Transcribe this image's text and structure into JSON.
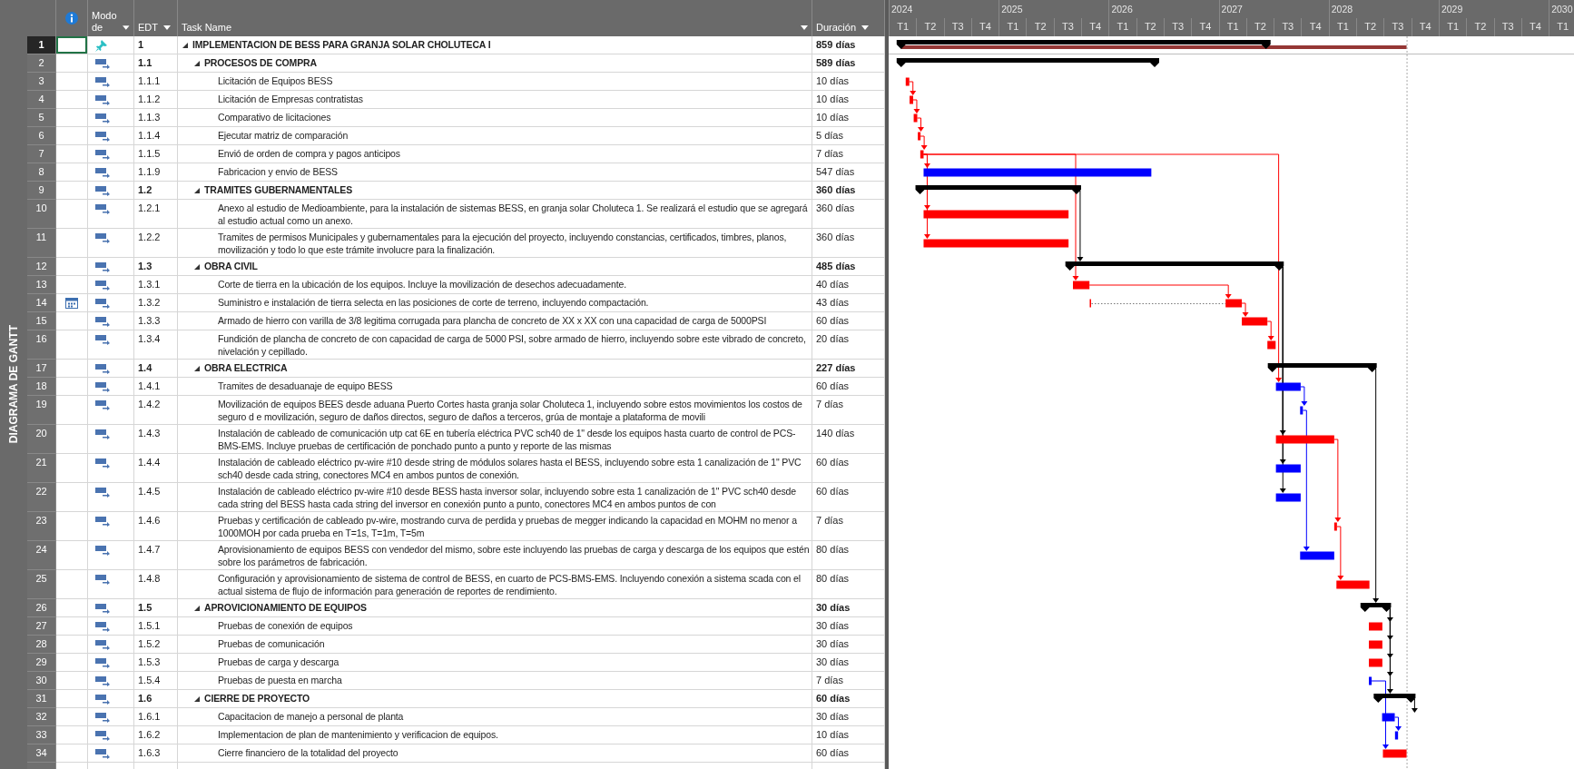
{
  "side_label": "DIAGRAMA DE GANTT",
  "columns": {
    "mode": "Modo de",
    "edt": "EDT",
    "name": "Task Name",
    "duration": "Duración"
  },
  "timeline": [
    {
      "year": "2024",
      "quarters": [
        "T1",
        "T2",
        "T3",
        "T4"
      ]
    },
    {
      "year": "2025",
      "quarters": [
        "T1",
        "T2",
        "T3",
        "T4"
      ]
    },
    {
      "year": "2026",
      "quarters": [
        "T1",
        "T2",
        "T3",
        "T4"
      ]
    },
    {
      "year": "2027",
      "quarters": [
        "T1",
        "T2",
        "T3",
        "T4"
      ]
    },
    {
      "year": "2028",
      "quarters": [
        "T1",
        "T2",
        "T3",
        "T4"
      ]
    },
    {
      "year": "2029",
      "quarters": [
        "T1",
        "T2",
        "T3",
        "T4"
      ]
    },
    {
      "year": "2030",
      "quarters": [
        "T1"
      ]
    }
  ],
  "tasks": [
    {
      "number": "1",
      "edt": "1",
      "name": "IMPLEMENTACION DE BESS PARA GRANJA SOLAR CHOLUTECA I",
      "duration": "859 días",
      "kind": "project",
      "manually_scheduled": true,
      "selected": true,
      "expanded": true,
      "children": [
        {
          "number": "2",
          "edt": "1.1",
          "name": "PROCESOS DE COMPRA",
          "duration": "589 días",
          "kind": "summary",
          "manually_scheduled": false,
          "selected": false,
          "expanded": true,
          "children": [
            {
              "number": "3",
              "edt": "1.1.1",
              "name": "Licitación de Equipos BESS",
              "duration": "10 días",
              "kind": "task",
              "manually_scheduled": false,
              "selected": false,
              "critical": true
            },
            {
              "number": "4",
              "edt": "1.1.2",
              "name": "Licitación de Empresas contratistas",
              "duration": "10 días",
              "kind": "task",
              "manually_scheduled": false,
              "selected": false,
              "critical": true
            },
            {
              "number": "5",
              "edt": "1.1.3",
              "name": "Comparativo de licitaciones",
              "duration": "10 días",
              "kind": "task",
              "manually_scheduled": false,
              "selected": false,
              "critical": true
            },
            {
              "number": "6",
              "edt": "1.1.4",
              "name": "Ejecutar matriz de comparación",
              "duration": "5 días",
              "kind": "task",
              "manually_scheduled": false,
              "selected": false,
              "critical": true
            },
            {
              "number": "7",
              "edt": "1.1.5",
              "name": "Envió de orden de compra y pagos anticipos",
              "duration": "7 días",
              "kind": "task",
              "manually_scheduled": false,
              "selected": false,
              "critical": true
            },
            {
              "number": "8",
              "edt": "1.1.9",
              "name": "Fabricacion y envio de BESS",
              "duration": "547 días",
              "kind": "task",
              "manually_scheduled": false,
              "selected": false,
              "critical": false
            }
          ]
        },
        {
          "number": "9",
          "edt": "1.2",
          "name": "TRAMITES GUBERNAMENTALES",
          "duration": "360 días",
          "kind": "summary",
          "manually_scheduled": false,
          "selected": false,
          "expanded": true,
          "children": [
            {
              "number": "10",
              "edt": "1.2.1",
              "name": "Anexo al estudio de Medioambiente, para la instalación de sistemas BESS, en granja solar Choluteca 1. Se realizará el estudio que se agregará al estudio actual como un anexo.",
              "duration": "360 días",
              "kind": "task",
              "manually_scheduled": false,
              "selected": false,
              "critical": true
            },
            {
              "number": "11",
              "edt": "1.2.2",
              "name": "Tramites de permisos Municipales y gubernamentales para la ejecución del proyecto, incluyendo constancias, certificados, timbres, planos, movilización y todo lo que este trámite involucre para la finalización.",
              "duration": "360 días",
              "kind": "task",
              "manually_scheduled": false,
              "selected": false,
              "critical": true
            }
          ]
        },
        {
          "number": "12",
          "edt": "1.3",
          "name": "OBRA CIVIL",
          "duration": "485 días",
          "kind": "summary",
          "manually_scheduled": false,
          "selected": false,
          "expanded": true,
          "children": [
            {
              "number": "13",
              "edt": "1.3.1",
              "name": "Corte de tierra en la ubicación de los equipos. Incluye la movilización de desechos adecuadamente.",
              "duration": "40 días",
              "kind": "task",
              "manually_scheduled": false,
              "selected": false,
              "critical": true
            },
            {
              "number": "14",
              "edt": "1.3.2",
              "name": "Suministro e instalación de tierra selecta en las posiciones de corte de terreno, incluyendo compactación.",
              "duration": "43 días",
              "kind": "task",
              "manually_scheduled": false,
              "selected": false,
              "critical": true,
              "calendar_indicator": true
            },
            {
              "number": "15",
              "edt": "1.3.3",
              "name": "Armado de hierro con varilla de 3/8 legitima corrugada para plancha de concreto de XX x XX con una capacidad de carga de 5000PSI",
              "duration": "60 días",
              "kind": "task",
              "manually_scheduled": false,
              "selected": false,
              "critical": true
            },
            {
              "number": "16",
              "edt": "1.3.4",
              "name": "Fundición de plancha de concreto de con capacidad de carga de 5000 PSI, sobre armado de hierro, incluyendo sobre este vibrado de concreto, nivelación y cepillado.",
              "duration": "20 días",
              "kind": "task",
              "manually_scheduled": false,
              "selected": false,
              "critical": true
            }
          ]
        },
        {
          "number": "17",
          "edt": "1.4",
          "name": "OBRA ELECTRICA",
          "duration": "227 días",
          "kind": "summary",
          "manually_scheduled": false,
          "selected": false,
          "expanded": true,
          "children": [
            {
              "number": "18",
              "edt": "1.4.1",
              "name": "Tramites de desaduanaje de equipo BESS",
              "duration": "60 días",
              "kind": "task",
              "manually_scheduled": false,
              "selected": false,
              "critical": false
            },
            {
              "number": "19",
              "edt": "1.4.2",
              "name": "Movilización de equipos BEES desde aduana Puerto Cortes hasta granja solar Choluteca 1, incluyendo sobre estos movimientos los costos de seguro d e movilización, seguro de daños directos, seguro de daños a terceros, grúa de montaje a plataforma de movili",
              "duration": "7 días",
              "kind": "task",
              "manually_scheduled": false,
              "selected": false,
              "critical": false
            },
            {
              "number": "20",
              "edt": "1.4.3",
              "name": "Instalación de cableado de comunicación utp cat 6E en tubería eléctrica PVC sch40 de 1\" desde los equipos hasta cuarto de control de PCS-BMS-EMS. Incluye pruebas de certificación de ponchado punto a punto y reporte de las mismas",
              "duration": "140 días",
              "kind": "task",
              "manually_scheduled": false,
              "selected": false,
              "critical": true
            },
            {
              "number": "21",
              "edt": "1.4.4",
              "name": "Instalación de cableado eléctrico pv-wire #10 desde string de módulos solares hasta el BESS, incluyendo sobre esta 1 canalización de 1\" PVC sch40 desde cada string, conectores MC4 en ambos puntos de conexión.",
              "duration": "60 días",
              "kind": "task",
              "manually_scheduled": false,
              "selected": false,
              "critical": false
            },
            {
              "number": "22",
              "edt": "1.4.5",
              "name": "Instalación de cableado eléctrico pv-wire #10 desde BESS hasta inversor solar, incluyendo sobre esta 1 canalización de 1\" PVC sch40 desde cada string del BESS hasta cada string del inversor en conexión punto a punto, conectores MC4 en ambos puntos de con",
              "duration": "60 días",
              "kind": "task",
              "manually_scheduled": false,
              "selected": false,
              "critical": false
            },
            {
              "number": "23",
              "edt": "1.4.6",
              "name": "Pruebas y certificación de cableado pv-wire, mostrando curva de perdida y pruebas de megger indicando la capacidad en MOHM no menor a 1000MOH por cada prueba en T=1s, T=1m, T=5m",
              "duration": "7 días",
              "kind": "task",
              "manually_scheduled": false,
              "selected": false,
              "critical": true
            },
            {
              "number": "24",
              "edt": "1.4.7",
              "name": "Aprovisionamiento de equipos BESS con vendedor del mismo, sobre este incluyendo las pruebas de carga y descarga de los equipos que estén sobre los parámetros de fabricación.",
              "duration": "80 días",
              "kind": "task",
              "manually_scheduled": false,
              "selected": false,
              "critical": false
            },
            {
              "number": "25",
              "edt": "1.4.8",
              "name": "Configuración y aprovisionamiento de sistema de control de BESS, en cuarto de PCS-BMS-EMS. Incluyendo conexión a sistema scada con el actual sistema de flujo de información para generación de reportes de rendimiento.",
              "duration": "80 días",
              "kind": "task",
              "manually_scheduled": false,
              "selected": false,
              "critical": true
            }
          ]
        },
        {
          "number": "26",
          "edt": "1.5",
          "name": "APROVICIONAMIENTO DE EQUIPOS",
          "duration": "30 días",
          "kind": "summary",
          "manually_scheduled": false,
          "selected": false,
          "expanded": true,
          "children": [
            {
              "number": "27",
              "edt": "1.5.1",
              "name": "Pruebas de conexión de equipos",
              "duration": "30 días",
              "kind": "task",
              "manually_scheduled": false,
              "selected": false,
              "critical": true
            },
            {
              "number": "28",
              "edt": "1.5.2",
              "name": "Pruebas de comunicación",
              "duration": "30 días",
              "kind": "task",
              "manually_scheduled": false,
              "selected": false,
              "critical": true
            },
            {
              "number": "29",
              "edt": "1.5.3",
              "name": "Pruebas de carga y descarga",
              "duration": "30 días",
              "kind": "task",
              "manually_scheduled": false,
              "selected": false,
              "critical": true
            },
            {
              "number": "30",
              "edt": "1.5.4",
              "name": "Pruebas de puesta en marcha",
              "duration": "7 días",
              "kind": "task",
              "manually_scheduled": false,
              "selected": false,
              "critical": false
            }
          ]
        },
        {
          "number": "31",
          "edt": "1.6",
          "name": "CIERRE DE PROYECTO",
          "duration": "60 días",
          "kind": "summary",
          "manually_scheduled": false,
          "selected": false,
          "expanded": true,
          "children": [
            {
              "number": "32",
              "edt": "1.6.1",
              "name": "Capacitacion de manejo a personal de planta",
              "duration": "30 días",
              "kind": "task",
              "manually_scheduled": false,
              "selected": false,
              "critical": false
            },
            {
              "number": "33",
              "edt": "1.6.2",
              "name": "Implementacion de plan de mantenimiento y verificacion de equipos.",
              "duration": "10 días",
              "kind": "task",
              "manually_scheduled": false,
              "selected": false,
              "critical": false
            },
            {
              "number": "34",
              "edt": "1.6.3",
              "name": "Cierre financiero de la totalidad del proyecto",
              "duration": "60 días",
              "kind": "task",
              "manually_scheduled": false,
              "selected": false,
              "critical": true
            }
          ]
        }
      ]
    }
  ]
}
